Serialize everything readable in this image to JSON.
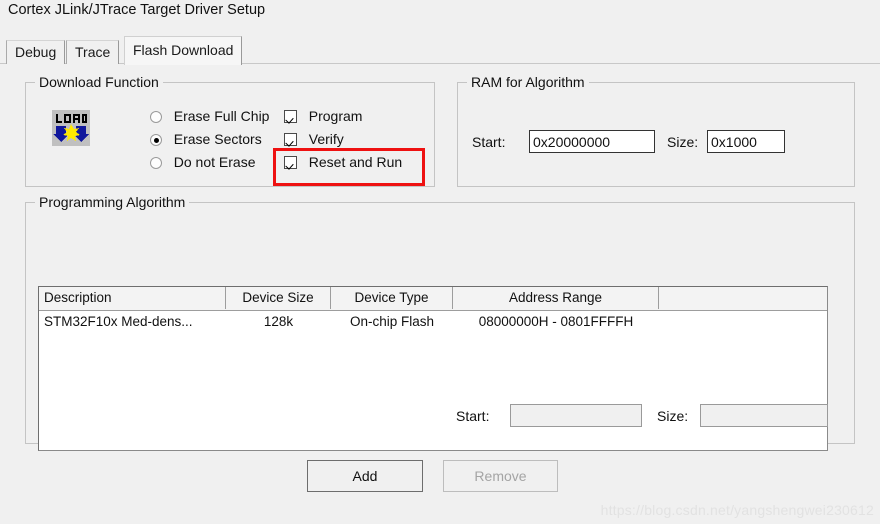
{
  "window": {
    "title": "Cortex JLink/JTrace Target Driver Setup"
  },
  "tabs": [
    {
      "label": "Debug",
      "active": false
    },
    {
      "label": "Trace",
      "active": false
    },
    {
      "label": "Flash Download",
      "active": true
    }
  ],
  "download_function": {
    "title": "Download Function",
    "icon_name": "load-icon",
    "icon_text": "LOAD",
    "erase_options": [
      {
        "label": "Erase Full Chip",
        "checked": false
      },
      {
        "label": "Erase Sectors",
        "checked": true
      },
      {
        "label": "Do not Erase",
        "checked": false
      }
    ],
    "checkboxes": [
      {
        "label": "Program",
        "checked": true
      },
      {
        "label": "Verify",
        "checked": true
      },
      {
        "label": "Reset and Run",
        "checked": true,
        "highlighted": true
      }
    ],
    "highlight_color": "#ee1111"
  },
  "ram_for_algorithm": {
    "title": "RAM for Algorithm",
    "start_label": "Start:",
    "start_value": "0x20000000",
    "size_label": "Size:",
    "size_value": "0x1000"
  },
  "programming_algorithm": {
    "title": "Programming Algorithm",
    "columns": [
      "Description",
      "Device Size",
      "Device Type",
      "Address Range",
      ""
    ],
    "rows": [
      {
        "description": "STM32F10x Med-dens...",
        "device_size": "128k",
        "device_type": "On-chip Flash",
        "address_range": "08000000H - 0801FFFFH",
        "extra": ""
      }
    ],
    "start_label": "Start:",
    "start_value": "",
    "size_label": "Size:",
    "size_value": ""
  },
  "buttons": {
    "add": "Add",
    "remove": "Remove"
  },
  "watermark": "https://blog.csdn.net/yangshengwei230612"
}
